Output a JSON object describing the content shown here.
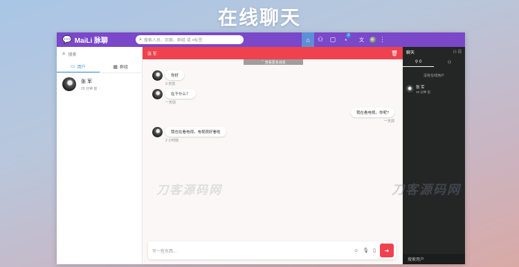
{
  "banner": {
    "title": "在线聊天"
  },
  "app": {
    "brand": "MaiLi 脉聊",
    "search_placeholder": "搜索人员、页面、群组 或 #标签",
    "lang": "文"
  },
  "topbar_icons": [
    {
      "icon": "home-icon",
      "glyph": "⌂",
      "active": true
    },
    {
      "icon": "add-user-icon",
      "glyph": "⚇"
    },
    {
      "icon": "chat-icon",
      "glyph": "▢"
    },
    {
      "icon": "bell-icon",
      "glyph": "◔",
      "badge": "2"
    }
  ],
  "left": {
    "search_label": "搜索",
    "tabs": [
      {
        "label": "用户",
        "icon": "chat-bubble-icon",
        "active": true
      },
      {
        "label": "群组",
        "icon": "grid-icon",
        "active": false
      }
    ],
    "contacts": [
      {
        "name": "张 军",
        "time": "29 分钟 前"
      }
    ]
  },
  "chat": {
    "peer_name": "张 军",
    "load_more": "查看更多消息",
    "messages": [
      {
        "side": "left",
        "text": "你好",
        "time": "3 天前"
      },
      {
        "side": "left",
        "text": "在干什么？",
        "time": "一天前"
      },
      {
        "side": "right",
        "text": "我在看电视。你呢?",
        "time": "一天前"
      },
      {
        "side": "left",
        "text": "我也在看电视。电视很好看啦",
        "time": "2 小时前"
      }
    ],
    "composer_placeholder": "写一些东西...",
    "watermark": "刀客源码网"
  },
  "right": {
    "title": "聊天",
    "online_count": "0",
    "empty_text": "没有在线用户",
    "users": [
      {
        "name": "张 军",
        "time": "29 分钟 前"
      }
    ],
    "search_label": "搜索用户"
  },
  "colors": {
    "topbar": "#7a48c9",
    "chat_header": "#f0414e",
    "right_panel": "#242625",
    "accent_blue": "#3a8fe0"
  }
}
